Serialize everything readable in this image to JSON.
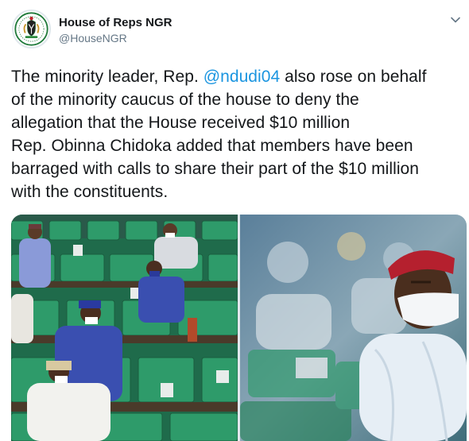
{
  "account": {
    "display_name": "House of Reps NGR",
    "handle": "@HouseNGR",
    "avatar_icon": "coat-of-arms-icon"
  },
  "menu": {
    "icon": "chevron-down-icon"
  },
  "tweet": {
    "line1_before": "The minority leader, Rep. ",
    "mention": "@ndudi04",
    "line1_after": " also rose on behalf",
    "line2": "of the minority caucus of the house to deny the",
    "line3": "allegation that the House received $10 million",
    "line4": "Rep. Obinna Chidoka added that members have been",
    "line5": "barraged with calls to share their part of the $10 million",
    "line6": "with the constituents."
  },
  "colors": {
    "mention": "#1b95e0",
    "chamber_seat_green": "#2e9b6a",
    "agbada_blue": "#3a4fb0",
    "red_cap": "#b5202e"
  }
}
